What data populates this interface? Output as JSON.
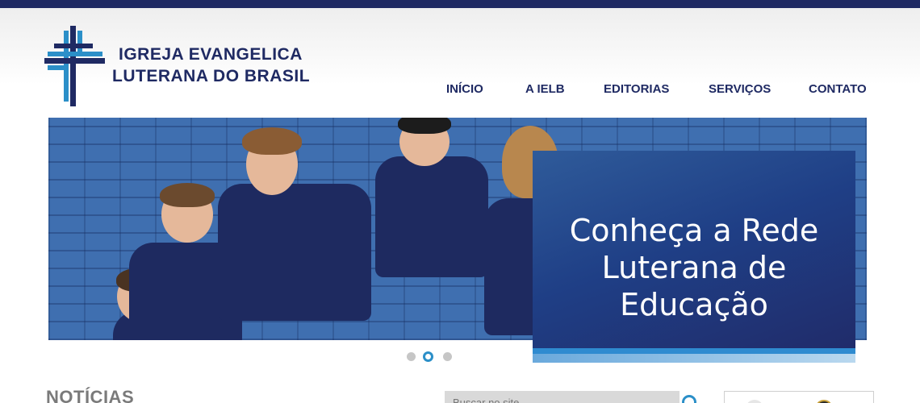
{
  "brand": {
    "line1": "IGREJA EVANGELICA",
    "line2": "LUTERANA DO BRASIL",
    "logo_icon": "cross-logo-icon",
    "primary_color": "#1f2a63",
    "accent_color": "#2b8fc8"
  },
  "nav": {
    "items": [
      {
        "label": "INÍCIO"
      },
      {
        "label": "A IELB"
      },
      {
        "label": "EDITORIAS"
      },
      {
        "label": "SERVIÇOS"
      },
      {
        "label": "CONTATO"
      }
    ]
  },
  "hero": {
    "promo_text": "Conheça a Rede Luterana de Educação",
    "slide_count": 3,
    "active_slide": 2
  },
  "news": {
    "title": "NOTÍCIAS"
  },
  "search": {
    "placeholder": "Buscar no site",
    "icon": "search-icon"
  }
}
